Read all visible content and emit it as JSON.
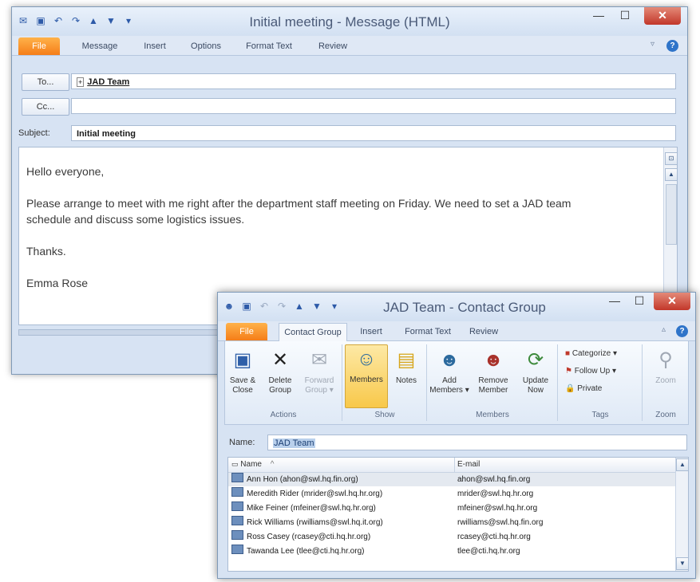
{
  "message_window": {
    "title": "Initial meeting - Message (HTML)",
    "qat_icons": [
      "outlook-icon",
      "save-icon",
      "undo-icon",
      "redo-icon",
      "up-arrow-icon",
      "down-arrow-icon",
      "customize-icon"
    ],
    "tabs": [
      "File",
      "Message",
      "Insert",
      "Options",
      "Format Text",
      "Review"
    ],
    "to_label": "To...",
    "cc_label": "Cc...",
    "subject_label": "Subject:",
    "to_value": "JAD Team",
    "cc_value": "",
    "subject_value": "Initial meeting",
    "body": {
      "greeting": "Hello everyone,",
      "line1": "Please arrange to meet with me right after the department staff meeting on Friday. We need to set a JAD team",
      "line2": "schedule and discuss some logistics issues.",
      "thanks": "Thanks.",
      "signature": "Emma Rose"
    }
  },
  "contact_group_window": {
    "title": "JAD Team - Contact Group",
    "tabs": [
      "File",
      "Contact Group",
      "Insert",
      "Format Text",
      "Review"
    ],
    "ribbon": {
      "actions": {
        "label": "Actions",
        "save_close": [
          "Save &",
          "Close"
        ],
        "delete_group": [
          "Delete",
          "Group"
        ],
        "forward_group": [
          "Forward",
          "Group"
        ]
      },
      "show": {
        "label": "Show",
        "members": "Members",
        "notes": "Notes"
      },
      "members_group": {
        "label": "Members",
        "add_members": [
          "Add",
          "Members"
        ],
        "remove_member": [
          "Remove",
          "Member"
        ],
        "update_now": [
          "Update",
          "Now"
        ]
      },
      "tags": {
        "label": "Tags",
        "categorize": "Categorize",
        "follow_up": "Follow Up",
        "private": "Private"
      },
      "zoom": {
        "label": "Zoom",
        "zoom": "Zoom"
      }
    },
    "name_label": "Name:",
    "name_value": "JAD Team",
    "columns": [
      "Name",
      "E-mail"
    ],
    "members": [
      {
        "name": "Ann Hon (ahon@swl.hq.fin.org)",
        "email": "ahon@swl.hq.fin.org"
      },
      {
        "name": "Meredith Rider (mrider@swl.hq.hr.org)",
        "email": "mrider@swl.hq.hr.org"
      },
      {
        "name": "Mike Feiner (mfeiner@swl.hq.hr.org)",
        "email": "mfeiner@swl.hq.hr.org"
      },
      {
        "name": "Rick Williams (rwilliams@swl.hq.it.org)",
        "email": "rwilliams@swl.hq.fin.org"
      },
      {
        "name": "Ross Casey (rcasey@cti.hq.hr.org)",
        "email": "rcasey@cti.hq.hr.org"
      },
      {
        "name": "Tawanda Lee (tlee@cti.hq.hr.org)",
        "email": "tlee@cti.hq.hr.org"
      }
    ]
  },
  "colors": {
    "file_tab": "#f57d18",
    "close_button": "#c2372a",
    "selection": "#f8c84a"
  }
}
